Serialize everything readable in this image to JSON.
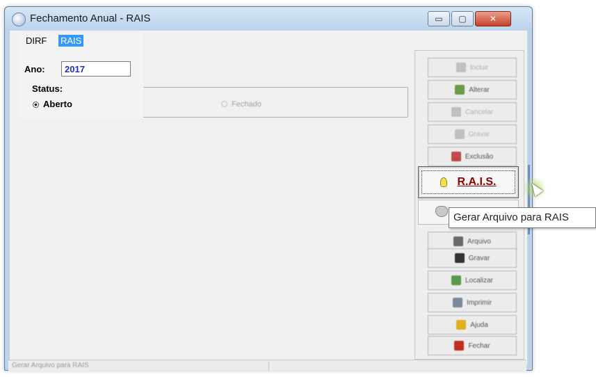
{
  "window": {
    "title": "Fechamento Anual - RAIS",
    "controls": {
      "minimize": "▭",
      "maximize": "▢",
      "close": "✕"
    }
  },
  "menu": {
    "items": [
      {
        "label": "DIRF",
        "active": false
      },
      {
        "label": "RAIS",
        "active": true
      }
    ]
  },
  "form": {
    "ano_label": "Ano:",
    "ano_value": "2017",
    "status_label": "Status:",
    "status_options": [
      {
        "label": "Aberto",
        "selected": true
      },
      {
        "label": "Fechado",
        "selected": false
      }
    ]
  },
  "toolbar": {
    "buttons": [
      {
        "label": "Incluir",
        "enabled": false,
        "icon": "add-icon",
        "color": "#c0c0c0"
      },
      {
        "label": "Alterar",
        "enabled": true,
        "icon": "edit-icon",
        "color": "#6a9a4a"
      },
      {
        "label": "Cancelar",
        "enabled": false,
        "icon": "cancel-icon",
        "color": "#c0c0c0"
      },
      {
        "label": "Gravar",
        "enabled": false,
        "icon": "check-icon",
        "color": "#c0c0c0"
      },
      {
        "label": "Exclusão",
        "enabled": true,
        "icon": "delete-icon",
        "color": "#c04a4a"
      },
      {
        "label": "Arquivo",
        "enabled": true,
        "icon": "file-icon",
        "color": "#6a6a6a"
      },
      {
        "label": "Gravar",
        "enabled": true,
        "icon": "save-icon",
        "color": "#333333"
      },
      {
        "label": "Localizar",
        "enabled": true,
        "icon": "search-icon",
        "color": "#5a9a4a"
      },
      {
        "label": "Imprimir",
        "enabled": true,
        "icon": "printer-icon",
        "color": "#7a8a9a"
      },
      {
        "label": "Ajuda",
        "enabled": true,
        "icon": "help-icon",
        "color": "#e0b020"
      },
      {
        "label": "Fechar",
        "enabled": true,
        "icon": "exit-icon",
        "color": "#c03020"
      }
    ],
    "rais_button": {
      "label": "R.A.I.S.",
      "icon": "lightbulb-icon"
    }
  },
  "tooltip": {
    "text": "Gerar Arquivo para RAIS"
  },
  "statusbar": {
    "text": "Gerar Arquivo para RAIS"
  },
  "colors": {
    "menu_active_bg": "#3399ff",
    "ano_value_color": "#1a2cc9",
    "rais_label_color": "#8b0000"
  }
}
